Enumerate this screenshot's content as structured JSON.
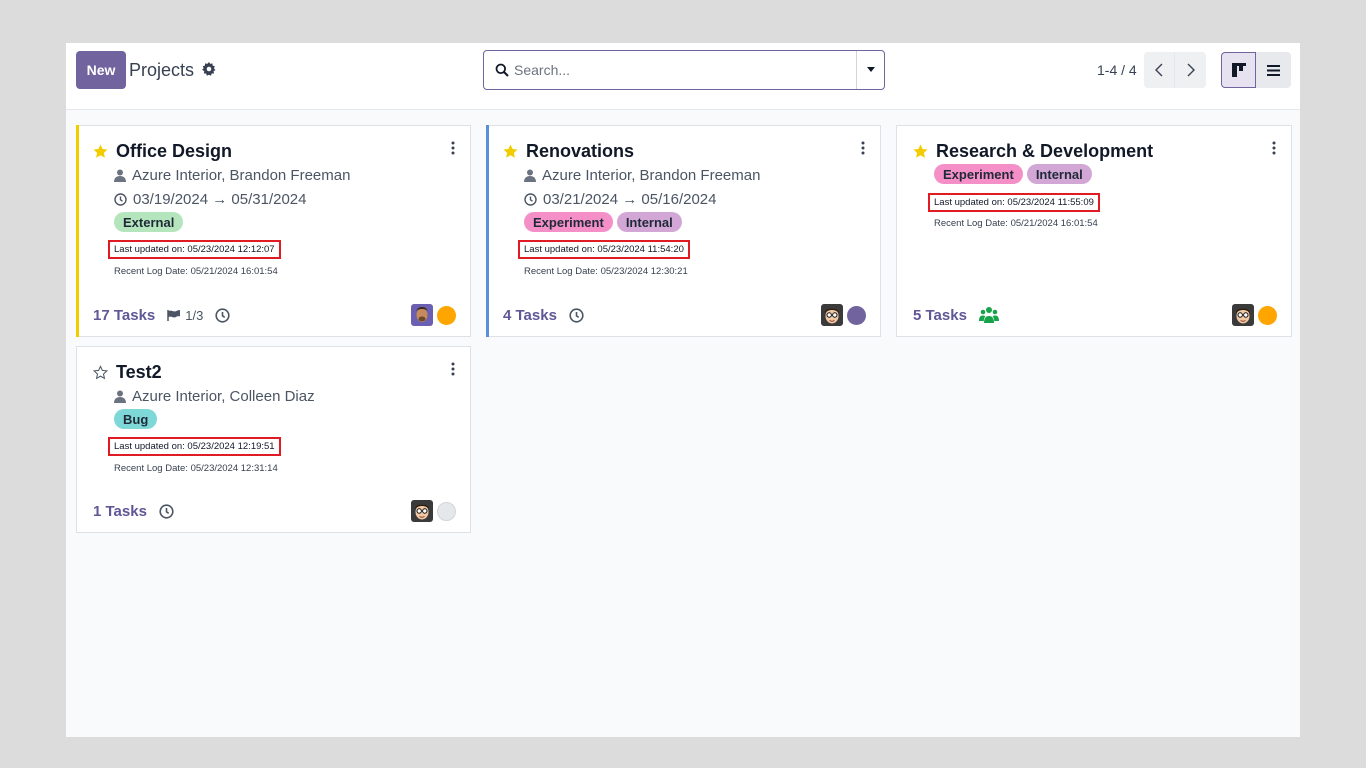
{
  "control_panel": {
    "new_button": "New",
    "title": "Projects",
    "search_placeholder": "Search...",
    "pager": "1-4 / 4"
  },
  "colors": {
    "brand": "#71639e",
    "favorite_star": "#f3cc00",
    "highlight": "#e01b24",
    "status_orange": "#ffa500",
    "status_purple": "#71639e",
    "status_grey": "#e5e7eb"
  },
  "cards": [
    {
      "name": "Office Design",
      "favorite": true,
      "partner": "Azure Interior, Brandon Freeman",
      "dates": "03/19/2024 → 05/31/2024",
      "tags": [
        "External"
      ],
      "last_updated": "Last updated on: 05/23/2024 12:12:07",
      "recent_log": "Recent Log Date: 05/21/2024 16:01:54",
      "tasks": "17 Tasks",
      "milestones": "1/3",
      "status_color": "orange",
      "color_bar": "#f3cc00"
    },
    {
      "name": "Renovations",
      "favorite": true,
      "partner": "Azure Interior, Brandon Freeman",
      "dates": "03/21/2024 → 05/16/2024",
      "tags": [
        "Experiment",
        "Internal"
      ],
      "last_updated": "Last updated on: 05/23/2024 11:54:20",
      "recent_log": "Recent Log Date: 05/23/2024 12:30:21",
      "tasks": "4 Tasks",
      "status_color": "purple",
      "color_bar": "#5b8fd8"
    },
    {
      "name": "Research & Development",
      "favorite": true,
      "tags": [
        "Experiment",
        "Internal"
      ],
      "last_updated": "Last updated on: 05/23/2024 11:55:09",
      "recent_log": "Recent Log Date: 05/21/2024 16:01:54",
      "tasks": "5 Tasks",
      "status_color": "orange",
      "icon": "users-icon"
    },
    {
      "name": "Test2",
      "favorite": false,
      "partner": "Azure Interior, Colleen Diaz",
      "tags": [
        "Bug"
      ],
      "last_updated": "Last updated on: 05/23/2024 12:19:51",
      "recent_log": "Recent Log Date: 05/23/2024 12:31:14",
      "tasks": "1 Tasks",
      "status_color": "grey"
    }
  ]
}
